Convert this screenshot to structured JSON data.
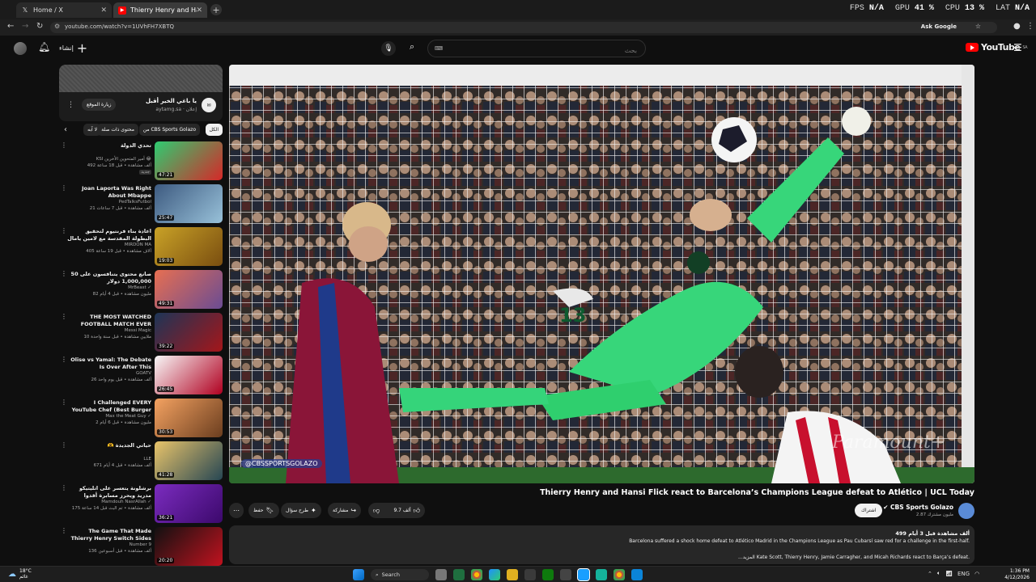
{
  "browser": {
    "tabs": [
      {
        "title": "Home / X",
        "icon": "x-logo-icon"
      },
      {
        "title": "Thierry Henry and Hansi Flick r",
        "icon": "youtube-icon"
      }
    ],
    "url": "youtube.com/watch?v=1UVhFH7XBTQ",
    "ask_google": "Ask Google",
    "perf": {
      "fps_label": "FPS",
      "fps": "N/A",
      "gpu_label": "GPU",
      "gpu": "41 %",
      "cpu_label": "CPU",
      "cpu": "13 %",
      "lat_label": "LAT",
      "lat": "N/A"
    }
  },
  "header": {
    "create_label": "إنشاء",
    "search_placeholder": "بحث",
    "logo_text": "YouTube",
    "logo_region": "SA"
  },
  "channel_card": {
    "name": "يا باغي الخير أقبل",
    "sub": "aytamg.sa · إعلان",
    "avatar_text": "✉",
    "visit_label": "زيارة الموقع"
  },
  "chips": {
    "all": "الكل",
    "cbs": "من CBS Sports Golazo",
    "related": "محتوى ذات صلة",
    "new": "لا آبه"
  },
  "sidebar_videos": [
    {
      "title": "تحدي الدولة",
      "channel": "KSI أمير المتحوين الأخرين 😂",
      "meta": "492 ألف مشاهدة • قبل 18 ساعة",
      "badge": "جديد",
      "duration": "47:21",
      "c1": "#2ecc71",
      "c2": "#d62828"
    },
    {
      "title": "Joan Laporta Was Right About Mbappe",
      "channel": "PedTalksFutbol",
      "meta": "21 ألف مشاهدة • قبل 7 ساعات",
      "badge": "",
      "duration": "25:47",
      "c1": "#3d5a80",
      "c2": "#98c1d9"
    },
    {
      "title": "اعادة بناء فرنتيوم لتحقيق البطولة المقدسة مع لامين يامال 🔥 FC26",
      "channel": "MIRDON MA",
      "meta": "405 آلاف مشاهدة • قبل 19 ساعة",
      "badge": "",
      "duration": "19:03",
      "c1": "#c9a227",
      "c2": "#7a4e10"
    },
    {
      "title": "50 صانع محتوى يتنافسون على 1,000,000 دولار",
      "channel": "MrBeast ✓",
      "meta": "82 مليون مشاهدة • قبل 4 أيام",
      "badge": "",
      "duration": "49:31",
      "c1": "#e76f51",
      "c2": "#6a4c93"
    },
    {
      "title": "THE MOST WATCHED FOOTBALL MATCH EVER (after",
      "channel": "Messi Magic",
      "meta": "10 ملايين مشاهدة • قبل سنة واحدة",
      "badge": "",
      "duration": "39:22",
      "c1": "#1d3557",
      "c2": "#a4161a"
    },
    {
      "title": "Olise vs Yamal: The Debate Is Over After This",
      "channel": "GOATV",
      "meta": "26 ألف مشاهدة • قبل يوم واحد",
      "badge": "",
      "duration": "26:45",
      "c1": "#f8f8f8",
      "c2": "#b00020"
    },
    {
      "title": "I Challenged EVERY YouTube Chef (Best Burger Wins)",
      "channel": "Max the Meat Guy ✓",
      "meta": "2 مليون مشاهدة • قبل 6 أيام",
      "badge": "",
      "duration": "30:53",
      "c1": "#f4a261",
      "c2": "#6b3e1f"
    },
    {
      "title": "🫶 حياتي الجديدة",
      "channel": "LLE",
      "meta": "671 ألف مشاهدة • قبل 4 أيام",
      "badge": "",
      "duration": "41:28",
      "c1": "#e9c46a",
      "c2": "#264653"
    },
    {
      "title": "برشلونة يتعسر على اتليتيكو مدريد ويحرز مسابرة أقدوا مشاهدة برشلونة قلبه لبه لا يجدل لزوجي...",
      "channel": "Mamdouh NasrAllah ✓",
      "meta": "175 ألف مشاهدة • تم البث قبل 14 ساعة",
      "badge": "",
      "duration": "36:21",
      "c1": "#7b2cbf",
      "c2": "#3c096c"
    },
    {
      "title": "The Game That Made Thierry Henry Switch Sides",
      "channel": "Number 9",
      "meta": "136 ألف مشاهدة • قبل أسبوعين",
      "badge": "",
      "duration": "20:20",
      "c1": "#111111",
      "c2": "#c1121f"
    }
  ],
  "player": {
    "watermark": "@CBSSPORTSGOLAZO",
    "broadcaster": "Paramount+"
  },
  "video": {
    "title": "Thierry Henry and Hansi Flick react to Barcelona’s Champions League defeat to Atlético | UCL Today",
    "owner_name": "CBS Sports Golazo",
    "owner_subs": "2.87 مليون مشترك",
    "subscribe_label": "اشتراك",
    "like_count": "9.7 ألف",
    "share_label": "مشاركة",
    "ask_label": "طرح سؤال",
    "save_label": "حفظ",
    "description": {
      "stats": "499 ألف مشاهدة  قبل 3 أيام",
      "line1": "Barcelona suffered a shock home defeat to Atlético Madrid in the Champions League as Pau Cubarsí saw red for a challenge in the first-half.",
      "line2": "...المزيد  Kate Scott, Thierry Henry, Jamie Carragher, and Micah Richards react to Barça’s defeat."
    }
  },
  "taskbar": {
    "weather_temp": "18°C",
    "weather_desc": "غائم",
    "search_label": "Search",
    "lang": "ENG",
    "time": "1:36 PM",
    "date": "4/12/2026"
  }
}
